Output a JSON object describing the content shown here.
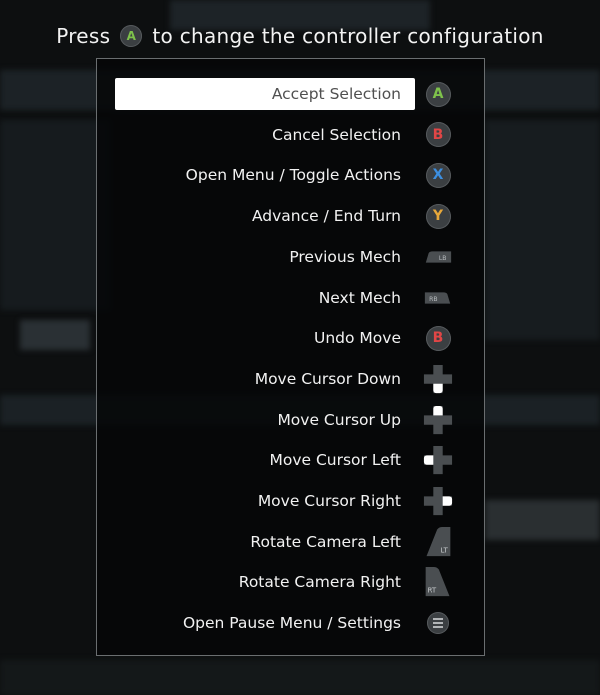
{
  "header": {
    "prefix": "Press",
    "icon": "a-button-icon",
    "suffix": "to change the controller configuration",
    "icon_letter": "A"
  },
  "colors": {
    "a": "#7ec24b",
    "b": "#e14646",
    "x": "#3d8fe0",
    "y": "#e8a83a",
    "selected_bg": "#ffffff",
    "selected_text": "#505050"
  },
  "bindings": [
    {
      "label": "Accept Selection",
      "icon": "a-button-icon",
      "glyph": "A",
      "selected": true
    },
    {
      "label": "Cancel Selection",
      "icon": "b-button-icon",
      "glyph": "B"
    },
    {
      "label": "Open Menu / Toggle Actions",
      "icon": "x-button-icon",
      "glyph": "X"
    },
    {
      "label": "Advance / End Turn",
      "icon": "y-button-icon",
      "glyph": "Y"
    },
    {
      "label": "Previous Mech",
      "icon": "lb-bumper-icon",
      "glyph": "LB"
    },
    {
      "label": "Next Mech",
      "icon": "rb-bumper-icon",
      "glyph": "RB"
    },
    {
      "label": "Undo Move",
      "icon": "b-button-icon",
      "glyph": "B"
    },
    {
      "label": "Move Cursor Down",
      "icon": "dpad-down-icon"
    },
    {
      "label": "Move Cursor Up",
      "icon": "dpad-up-icon"
    },
    {
      "label": "Move Cursor Left",
      "icon": "dpad-left-icon"
    },
    {
      "label": "Move Cursor Right",
      "icon": "dpad-right-icon"
    },
    {
      "label": "Rotate Camera Left",
      "icon": "lt-trigger-icon",
      "glyph": "LT"
    },
    {
      "label": "Rotate Camera Right",
      "icon": "rt-trigger-icon",
      "glyph": "RT"
    },
    {
      "label": "Open Pause Menu / Settings",
      "icon": "menu-button-icon"
    }
  ]
}
